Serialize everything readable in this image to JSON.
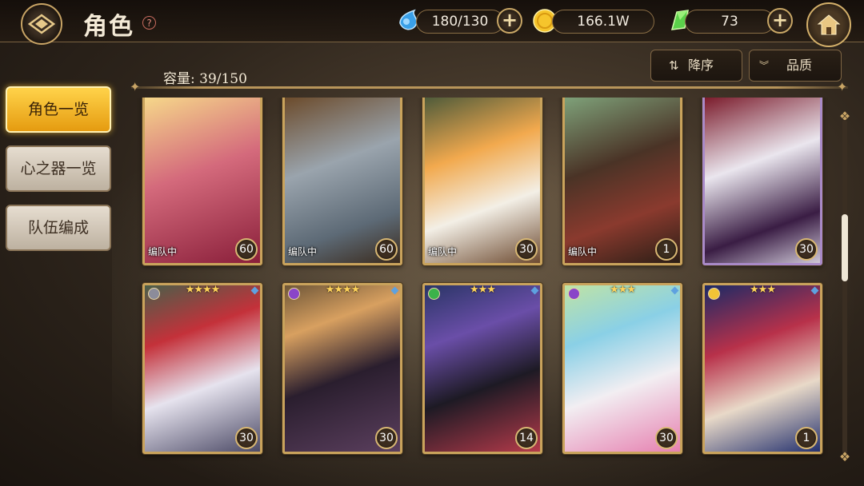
{
  "header": {
    "title": "角色",
    "help_label": "?",
    "stamina": "180/130",
    "gold": "166.1W",
    "gems": "73",
    "plus_label": "+"
  },
  "sort": {
    "order_label": "降序",
    "quality_label": "品质"
  },
  "capacity_text": "容量: 39/150",
  "side_menu": [
    {
      "label": "角色一览",
      "active": true
    },
    {
      "label": "心之器一览",
      "active": false
    },
    {
      "label": "队伍编成",
      "active": false
    }
  ],
  "cards_row1": [
    {
      "party": "编队中",
      "level": "60"
    },
    {
      "party": "编队中",
      "level": "60"
    },
    {
      "party": "编队中",
      "level": "30"
    },
    {
      "party": "编队中",
      "level": "1"
    },
    {
      "party": "",
      "level": "30"
    }
  ],
  "cards_row2": [
    {
      "stars": "★★★★",
      "level": "30"
    },
    {
      "stars": "★★★★",
      "level": "30"
    },
    {
      "stars": "★★★",
      "level": "14"
    },
    {
      "stars": "★★★",
      "level": "30"
    },
    {
      "stars": "★★★",
      "level": "1"
    }
  ],
  "colors": {
    "accent_gold": "#c9a35c",
    "active_tab": "#f2b52a",
    "panel_dark": "#2a2016"
  }
}
